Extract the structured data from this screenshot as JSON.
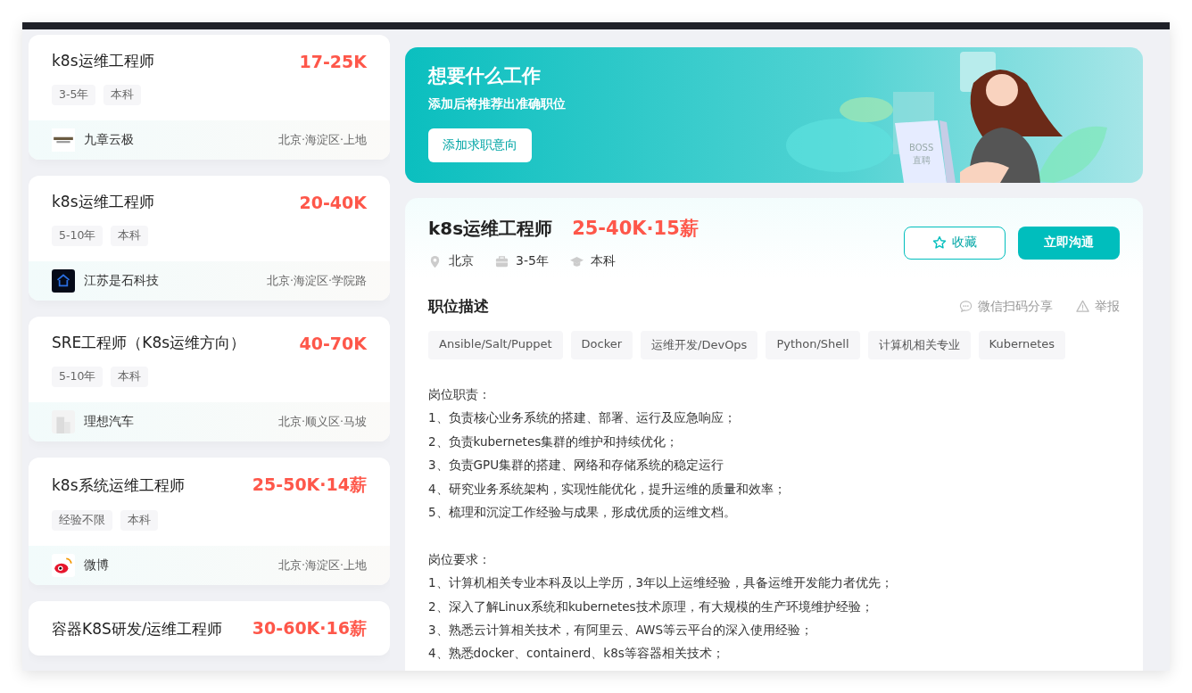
{
  "job_list": [
    {
      "title": "k8s运维工程师",
      "salary": "17-25K",
      "tags": [
        "3-5年",
        "本科"
      ],
      "company": "九章云极",
      "location": "北京·海淀区·上地",
      "kind": "text"
    },
    {
      "title": "k8s运维工程师",
      "salary": "20-40K",
      "tags": [
        "5-10年",
        "本科"
      ],
      "company": "江苏是石科技",
      "location": "北京·海淀区·学院路",
      "kind": "dark"
    },
    {
      "title": "SRE工程师（K8s运维方向）",
      "salary": "40-70K",
      "tags": [
        "5-10年",
        "本科"
      ],
      "company": "理想汽车",
      "location": "北京·顺义区·马坡",
      "kind": "building"
    },
    {
      "title": "k8s系统运维工程师",
      "salary": "25-50K·14薪",
      "tags": [
        "经验不限",
        "本科"
      ],
      "company": "微博",
      "location": "北京·海淀区·上地",
      "kind": "weibo"
    },
    {
      "title": "容器K8S研发/运维工程师",
      "salary": "30-60K·16薪"
    }
  ],
  "banner": {
    "title": "想要什么工作",
    "subtitle": "添加后将推荐出准确职位",
    "button": "添加求职意向",
    "laptop_text": [
      "BOSS",
      "直聘"
    ]
  },
  "detail": {
    "title": "k8s运维工程师",
    "salary": "25-40K·15薪",
    "city": "北京",
    "experience": "3-5年",
    "degree": "本科",
    "favorite_button": "收藏",
    "chat_button": "立即沟通",
    "section_title": "职位描述",
    "share": "微信扫码分享",
    "report": "举报",
    "skills": [
      "Ansible/Salt/Puppet",
      "Docker",
      "运维开发/DevOps",
      "Python/Shell",
      "计算机相关专业",
      "Kubernetes"
    ],
    "description": [
      [
        "岗位职责：",
        "1、负责核心业务系统的搭建、部署、运行及应急响应；",
        "2、负责kubernetes集群的维护和持续优化；",
        "3、负责GPU集群的搭建、网络和存储系统的稳定运行",
        "4、研究业务系统架构，实现性能优化，提升运维的质量和效率；",
        "5、梳理和沉淀工作经验与成果，形成优质的运维文档。"
      ],
      [
        "岗位要求：",
        "1、计算机相关专业本科及以上学历，3年以上运维经验，具备运维开发能力者优先；",
        "2、深入了解Linux系统和kubernetes技术原理，有大规模的生产环境维护经验；",
        "3、熟悉云计算相关技术，有阿里云、AWS等云平台的深入使用经验；",
        "4、熟悉docker、containerd、k8s等容器相关技术；"
      ]
    ]
  }
}
